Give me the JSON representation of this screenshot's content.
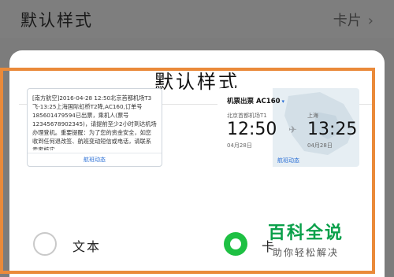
{
  "background": {
    "title": "默认样式",
    "value": "卡片",
    "chevron": "›"
  },
  "sheet": {
    "title": "默认样式"
  },
  "sms_card": {
    "text": "[南方航空]2016-04-28 12:50北京首都机场T3飞-13:25上海国际虹桥T2降,AC160,订单号185601479594已出票，乘机人(票号12345678902345)，请提前至少2小时到达机场办理登机。重要提醒：为了您的资金安全，如您收到任何退改签、航班变动短信或电话，请联系卖家核实。",
    "footer": "航班动态"
  },
  "flight_card": {
    "header": "机票出票 AC160",
    "caret": "▾",
    "from_city": "北京首都机场T1",
    "to_city": "上海",
    "from_time": "12:50",
    "to_time": "13:25",
    "from_date": "04月28日",
    "to_date": "04月28日",
    "plane": "✈",
    "footer": "航班动态"
  },
  "options": {
    "text_label": "文本",
    "card_label": "卡",
    "selected": "card"
  },
  "watermark": {
    "title": "百科全说",
    "subtitle": "助你轻松解决"
  },
  "colors": {
    "accent_orange": "#ea8a3a",
    "selected_green": "#1ec043",
    "link_blue": "#2a6fd6"
  }
}
